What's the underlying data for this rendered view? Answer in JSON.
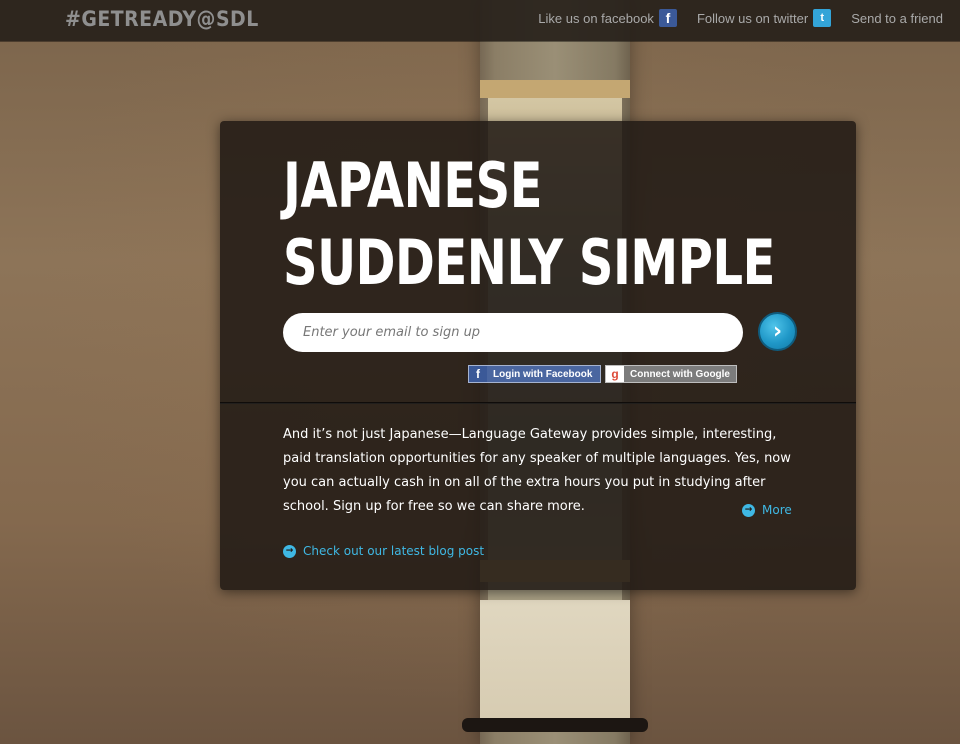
{
  "header": {
    "logo": "#GETREADY@SDL",
    "nav": [
      {
        "label": "Like us on facebook",
        "icon": "facebook-icon",
        "glyph": "f"
      },
      {
        "label": "Follow us on twitter",
        "icon": "twitter-icon",
        "glyph": "t"
      },
      {
        "label": "Send to a friend"
      }
    ]
  },
  "hero": {
    "headline_line1": "JAPANESE",
    "headline_line2": "SUDDENLY SIMPLE",
    "email_placeholder": "Enter your email to sign up",
    "submit_glyph": "›",
    "facebook_button": {
      "label": "Login with Facebook",
      "glyph": "f"
    },
    "google_button": {
      "label": "Connect with Google",
      "glyph": "g"
    }
  },
  "content": {
    "body": "And it’s not just Japanese—Language Gateway provides simple, interesting, paid translation opportunities for any speaker of multiple languages. Yes, now you can actually cash in on all of the extra hours you put in studying after school. Sign up for free so we can share more.",
    "more_link": "More",
    "blog_link": "Check out our latest blog post",
    "link_arrow": "→"
  },
  "colors": {
    "accent": "#3fb8e4",
    "facebook": "#3b5998",
    "twitter": "#33a4d8",
    "card": "#201914"
  }
}
